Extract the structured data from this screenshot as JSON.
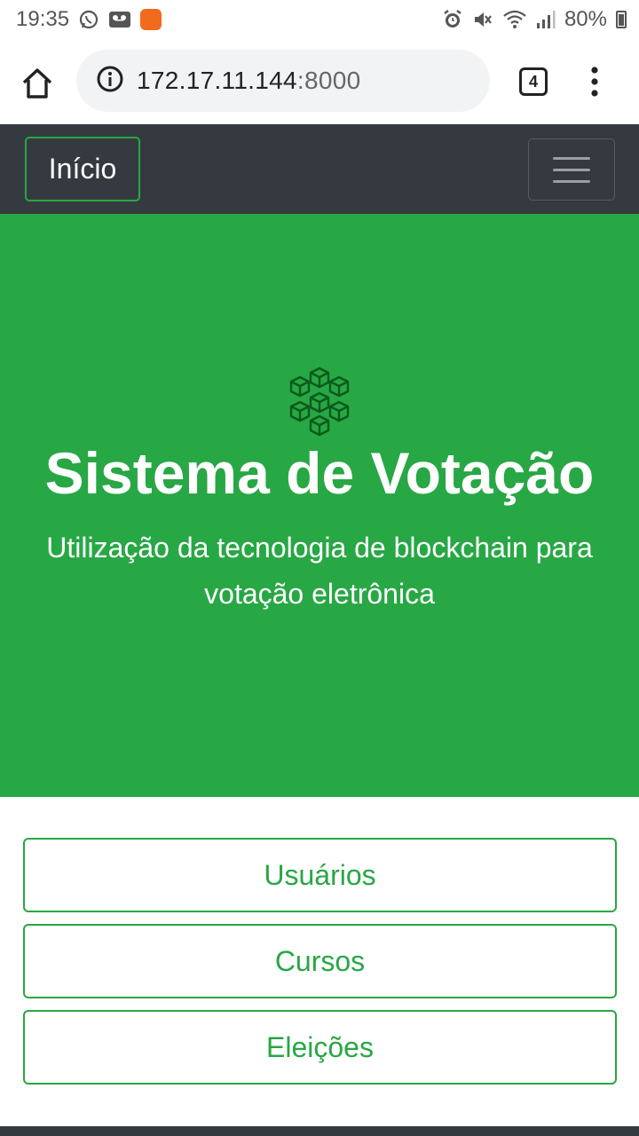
{
  "status_bar": {
    "time": "19:35",
    "battery": "80%",
    "left_icons": [
      "whatsapp-icon",
      "voicemail-icon",
      "mi-app-icon"
    ],
    "right_icons": [
      "alarm-icon",
      "mute-icon",
      "wifi-icon",
      "signal-icon",
      "battery-icon"
    ]
  },
  "browser": {
    "url_host": "172.17.11.144",
    "url_port": ":8000",
    "tab_count": "4"
  },
  "navbar": {
    "brand": "Início"
  },
  "hero": {
    "icon": "blockchain-icon",
    "title": "Sistema de Votação",
    "subtitle": "Utilização da tecnologia de blockchain para votação eletrônica"
  },
  "buttons": [
    {
      "label": "Usuários"
    },
    {
      "label": "Cursos"
    },
    {
      "label": "Eleições"
    }
  ],
  "colors": {
    "primary_green": "#28a745",
    "navbar_dark": "#343a40"
  }
}
